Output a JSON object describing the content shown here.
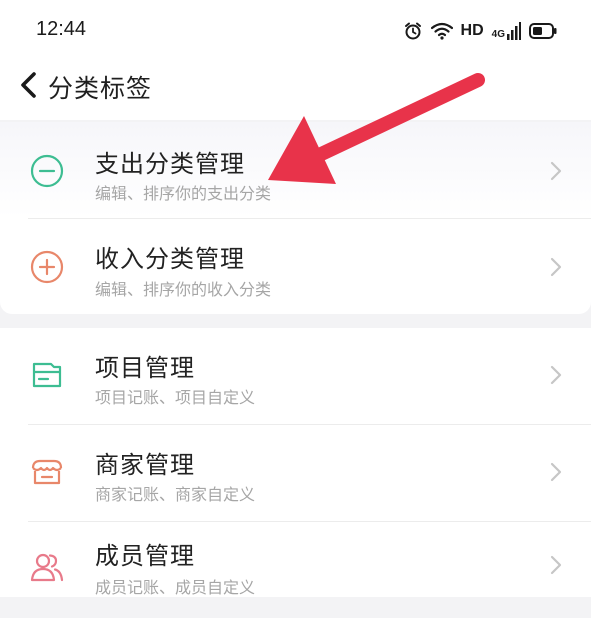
{
  "status": {
    "time": "12:44",
    "hd": "HD",
    "network": "4G"
  },
  "header": {
    "title": "分类标签"
  },
  "group1": [
    {
      "name": "支出分类管理",
      "desc": "编辑、排序你的支出分类",
      "icon": "minus-circle-icon",
      "color": "#3dbd92"
    },
    {
      "name": "收入分类管理",
      "desc": "编辑、排序你的收入分类",
      "icon": "plus-circle-icon",
      "color": "#e8876a"
    }
  ],
  "group2": [
    {
      "name": "项目管理",
      "desc": "项目记账、项目自定义",
      "icon": "folder-icon",
      "color": "#3dbd92"
    },
    {
      "name": "商家管理",
      "desc": "商家记账、商家自定义",
      "icon": "shop-icon",
      "color": "#e8876a"
    },
    {
      "name": "成员管理",
      "desc": "成员记账、成员自定义",
      "icon": "members-icon",
      "color": "#e87a8a"
    }
  ],
  "colors": {
    "arrow": "#e8334a",
    "chevron": "#c6c6c6",
    "background": "#f3f3f5"
  }
}
